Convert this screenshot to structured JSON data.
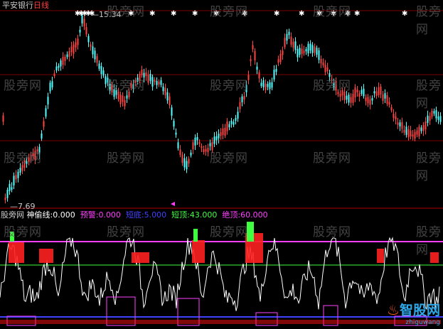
{
  "header": {
    "stock_name": "平安银行",
    "period": "日线"
  },
  "price_panel": {
    "high_label": "15.34",
    "low_label": "7.69",
    "high_value": 15.34,
    "low_value": 7.69
  },
  "indicator_panel": {
    "source": "股旁网",
    "name": "神偷线:",
    "items": [
      {
        "label": "神偷线:",
        "value": "0.000",
        "color": "#ffffff"
      },
      {
        "label": "预警:",
        "value": "0.000",
        "color": "#ff3cff"
      },
      {
        "label": "短底:",
        "value": "5.000",
        "color": "#4040ff"
      },
      {
        "label": "短顶:",
        "value": "43.000",
        "color": "#40ff40"
      },
      {
        "label": "绝顶:",
        "value": "60.000",
        "color": "#ff40ff"
      }
    ]
  },
  "watermark": "股旁网",
  "logo": {
    "brand": "智股网",
    "url": "zhiguwang"
  },
  "colors": {
    "up": "#ff4444",
    "down": "#54ffff",
    "grid": "#8b0000",
    "background": "#000000"
  }
}
